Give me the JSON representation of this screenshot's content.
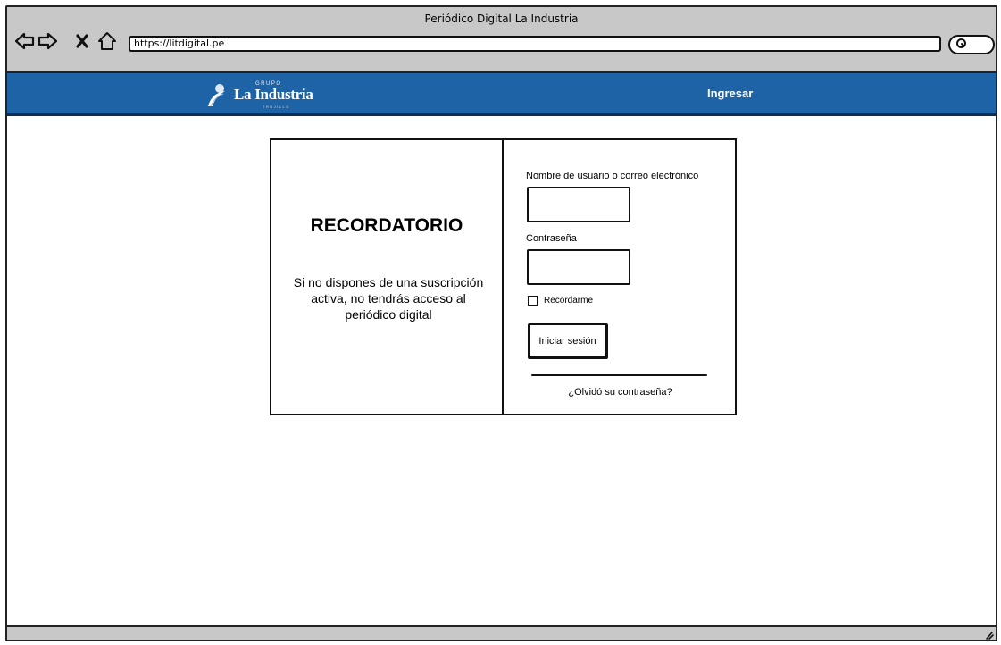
{
  "window": {
    "title": "Periódico Digital La Industria"
  },
  "browser": {
    "url": "https://litdigital.pe",
    "back_icon": "arrow-left-icon",
    "forward_icon": "arrow-right-icon",
    "stop_icon": "close-icon",
    "home_icon": "home-icon",
    "search_icon": "search-icon"
  },
  "header": {
    "logo_top": "GRUPO",
    "logo_main": "La Industria",
    "logo_sub": "TRUJILLO",
    "login_link": "Ingresar",
    "bar_color": "#1f63a7"
  },
  "reminder": {
    "title": "RECORDATORIO",
    "text": "Si no dispones de una suscripción activa, no tendrás acceso al periódico digital"
  },
  "login_form": {
    "username_label": "Nombre de usuario o correo electrónico",
    "username_value": "",
    "password_label": "Contraseña",
    "password_value": "",
    "remember_label": "Recordarme",
    "remember_checked": false,
    "submit_label": "Iniciar sesión",
    "forgot_link": "¿Olvidó su contraseña?"
  }
}
